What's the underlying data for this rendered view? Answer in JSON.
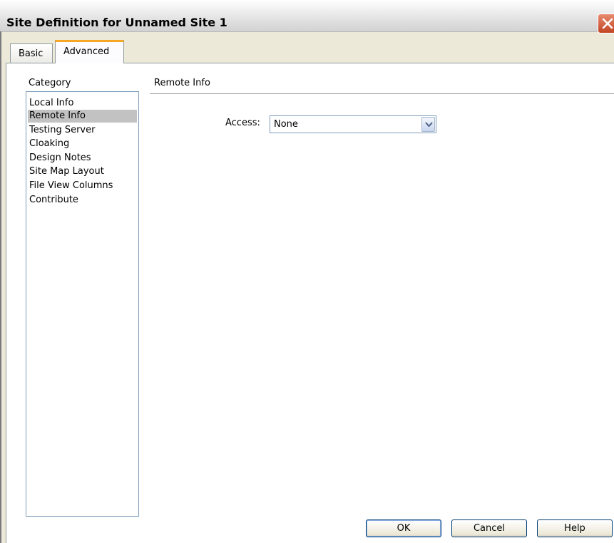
{
  "window": {
    "title": "Site Definition for Unnamed Site 1"
  },
  "tabs": [
    {
      "label": "Basic",
      "active": false
    },
    {
      "label": "Advanced",
      "active": true
    }
  ],
  "category": {
    "label": "Category",
    "items": [
      {
        "label": "Local Info"
      },
      {
        "label": "Remote Info",
        "selected": true
      },
      {
        "label": "Testing Server"
      },
      {
        "label": "Cloaking"
      },
      {
        "label": "Design Notes"
      },
      {
        "label": "Site Map Layout"
      },
      {
        "label": "File View Columns"
      },
      {
        "label": "Contribute"
      }
    ]
  },
  "section": {
    "title": "Remote Info",
    "access_label": "Access:",
    "access_value": "None"
  },
  "buttons": {
    "ok": "OK",
    "cancel": "Cancel",
    "help": "Help"
  },
  "colors": {
    "selected_item": "#c2c2c2",
    "active_tab_accent": "#f5a623",
    "close_button": "#c24424"
  }
}
